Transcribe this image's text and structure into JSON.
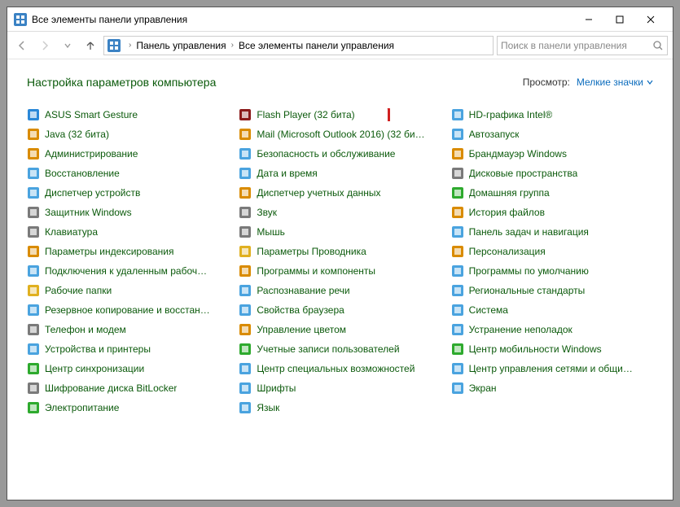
{
  "window": {
    "title": "Все элементы панели управления"
  },
  "breadcrumb": {
    "part1": "Панель управления",
    "part2": "Все элементы панели управления"
  },
  "search": {
    "placeholder": "Поиск в панели управления"
  },
  "heading": "Настройка параметров компьютера",
  "view": {
    "label": "Просмотр:",
    "value": "Мелкие значки"
  },
  "cols": [
    [
      {
        "label": "ASUS Smart Gesture",
        "ic": "#2a88d8"
      },
      {
        "label": "Java (32 бита)",
        "ic": "#d98b00"
      },
      {
        "label": "Администрирование",
        "ic": "#d98b00"
      },
      {
        "label": "Восстановление",
        "ic": "#4aa3df"
      },
      {
        "label": "Диспетчер устройств",
        "ic": "#4aa3df"
      },
      {
        "label": "Защитник Windows",
        "ic": "#7a7a7a"
      },
      {
        "label": "Клавиатура",
        "ic": "#7a7a7a"
      },
      {
        "label": "Параметры индексирования",
        "ic": "#d98b00"
      },
      {
        "label": "Подключения к удаленным рабоч…",
        "ic": "#4aa3df"
      },
      {
        "label": "Рабочие папки",
        "ic": "#e0b020"
      },
      {
        "label": "Резервное копирование и восстан…",
        "ic": "#4aa3df"
      },
      {
        "label": "Телефон и модем",
        "ic": "#7a7a7a"
      },
      {
        "label": "Устройства и принтеры",
        "ic": "#4aa3df"
      },
      {
        "label": "Центр синхронизации",
        "ic": "#2eaa2e"
      },
      {
        "label": "Шифрование диска BitLocker",
        "ic": "#7a7a7a"
      },
      {
        "label": "Электропитание",
        "ic": "#2eaa2e"
      }
    ],
    [
      {
        "label": "Flash Player (32 бита)",
        "ic": "#8b1a1a",
        "hl": true
      },
      {
        "label": "Mail (Microsoft Outlook 2016) (32 би…",
        "ic": "#d98b00"
      },
      {
        "label": "Безопасность и обслуживание",
        "ic": "#4aa3df"
      },
      {
        "label": "Дата и время",
        "ic": "#4aa3df"
      },
      {
        "label": "Диспетчер учетных данных",
        "ic": "#d98b00"
      },
      {
        "label": "Звук",
        "ic": "#7a7a7a"
      },
      {
        "label": "Мышь",
        "ic": "#7a7a7a"
      },
      {
        "label": "Параметры Проводника",
        "ic": "#e0b020"
      },
      {
        "label": "Программы и компоненты",
        "ic": "#d98b00"
      },
      {
        "label": "Распознавание речи",
        "ic": "#4aa3df"
      },
      {
        "label": "Свойства браузера",
        "ic": "#4aa3df"
      },
      {
        "label": "Управление цветом",
        "ic": "#d98b00"
      },
      {
        "label": "Учетные записи пользователей",
        "ic": "#2eaa2e"
      },
      {
        "label": "Центр специальных возможностей",
        "ic": "#4aa3df"
      },
      {
        "label": "Шрифты",
        "ic": "#4aa3df"
      },
      {
        "label": "Язык",
        "ic": "#4aa3df"
      }
    ],
    [
      {
        "label": "HD-графика Intel®",
        "ic": "#4aa3df"
      },
      {
        "label": "Автозапуск",
        "ic": "#4aa3df"
      },
      {
        "label": "Брандмауэр Windows",
        "ic": "#d98b00"
      },
      {
        "label": "Дисковые пространства",
        "ic": "#7a7a7a"
      },
      {
        "label": "Домашняя группа",
        "ic": "#2eaa2e"
      },
      {
        "label": "История файлов",
        "ic": "#d98b00"
      },
      {
        "label": "Панель задач и навигация",
        "ic": "#4aa3df"
      },
      {
        "label": "Персонализация",
        "ic": "#d98b00"
      },
      {
        "label": "Программы по умолчанию",
        "ic": "#4aa3df"
      },
      {
        "label": "Региональные стандарты",
        "ic": "#4aa3df"
      },
      {
        "label": "Система",
        "ic": "#4aa3df"
      },
      {
        "label": "Устранение неполадок",
        "ic": "#4aa3df"
      },
      {
        "label": "Центр мобильности Windows",
        "ic": "#2eaa2e"
      },
      {
        "label": "Центр управления сетями и общи…",
        "ic": "#4aa3df"
      },
      {
        "label": "Экран",
        "ic": "#4aa3df"
      }
    ]
  ]
}
